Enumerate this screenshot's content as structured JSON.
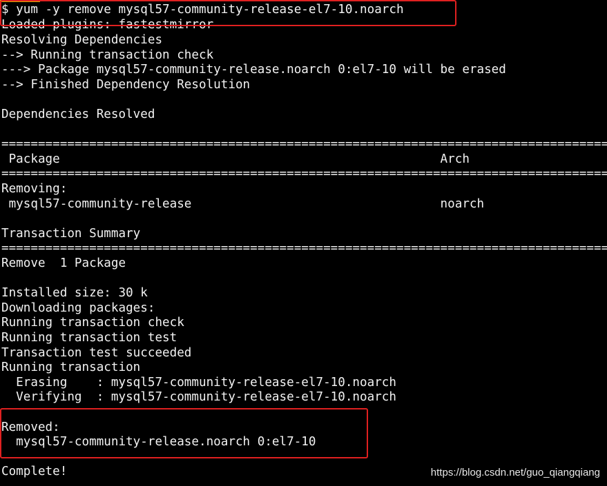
{
  "terminal": {
    "command_prompt": "$",
    "command": " yum -y remove mysql57-community-release-el7-10.noarch",
    "lines": [
      "Loaded plugins: fastestmirror",
      "Resolving Dependencies",
      "--> Running transaction check",
      "---> Package mysql57-community-release.noarch 0:el7-10 will be erased",
      "--> Finished Dependency Resolution",
      "",
      "Dependencies Resolved",
      "",
      "====================================================================================================",
      " Package                                                    Arch",
      "====================================================================================================",
      "Removing:",
      " mysql57-community-release                                  noarch",
      "",
      "Transaction Summary",
      "====================================================================================================",
      "Remove  1 Package",
      "",
      "Installed size: 30 k",
      "Downloading packages:",
      "Running transaction check",
      "Running transaction test",
      "Transaction test succeeded",
      "Running transaction",
      "  Erasing    : mysql57-community-release-el7-10.noarch",
      "  Verifying  : mysql57-community-release-el7-10.noarch",
      "",
      "Removed:",
      "  mysql57-community-release.noarch 0:el7-10",
      "",
      "Complete!"
    ]
  },
  "watermark": "https://blog.csdn.net/guo_qiangqiang",
  "colors": {
    "background": "#000000",
    "text": "#f2f2f2",
    "highlight_box": "#e02020"
  }
}
